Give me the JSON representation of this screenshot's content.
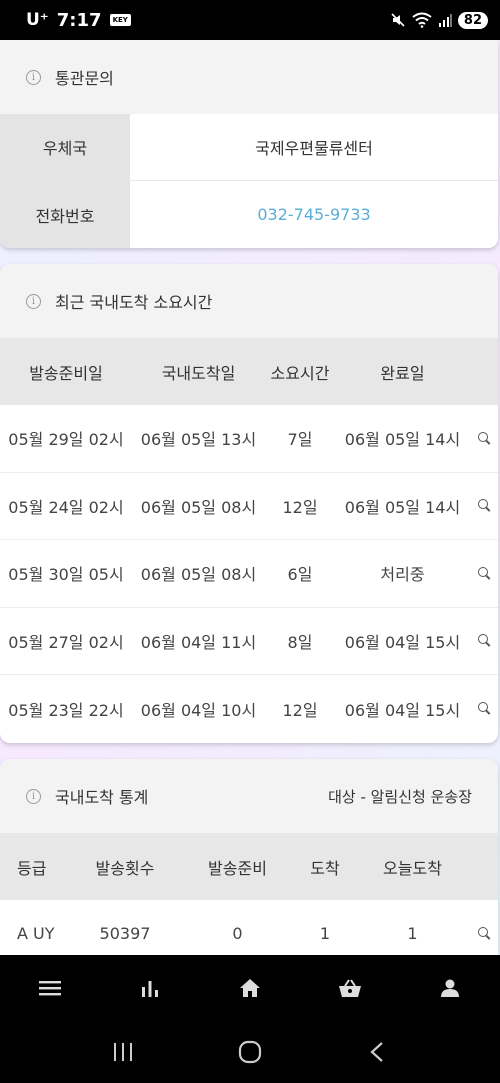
{
  "status_bar": {
    "carrier": "U⁺",
    "time": "7:17",
    "key_badge": "KEY",
    "battery": "82"
  },
  "customs": {
    "title": "통관문의",
    "rows": [
      {
        "label": "우체국",
        "value": "국제우편물류센터"
      },
      {
        "label": "전화번호",
        "value": "032-745-9733"
      }
    ]
  },
  "arrival": {
    "title": "최근 국내도착 소요시간",
    "headers": [
      "발송준비일",
      "국내도착일",
      "소요시간",
      "완료일"
    ],
    "rows": [
      {
        "ready": "05월 29일 02시",
        "arrived": "06월 05일 13시",
        "duration": "7일",
        "done": "06월 05일 14시"
      },
      {
        "ready": "05월 24일 02시",
        "arrived": "06월 05일 08시",
        "duration": "12일",
        "done": "06월 05일 14시"
      },
      {
        "ready": "05월 30일 05시",
        "arrived": "06월 05일 08시",
        "duration": "6일",
        "done": "처리중"
      },
      {
        "ready": "05월 27일 02시",
        "arrived": "06월 04일 11시",
        "duration": "8일",
        "done": "06월 04일 15시"
      },
      {
        "ready": "05월 23일 22시",
        "arrived": "06월 04일 10시",
        "duration": "12일",
        "done": "06월 04일 15시"
      }
    ]
  },
  "stats": {
    "title": "국내도착 통계",
    "subtitle": "대상 - 알림신청 운송장",
    "headers": [
      "등급",
      "발송횟수",
      "발송준비",
      "도착",
      "오늘도착"
    ],
    "rows": [
      {
        "grade": "A UY",
        "sent": "50397",
        "ready": "0",
        "arrived": "1",
        "today": "1"
      }
    ]
  },
  "icons": {
    "info": "info-circle-icon",
    "search": "search-icon",
    "nav": [
      "menu-icon",
      "bar-chart-icon",
      "home-icon",
      "basket-icon",
      "person-icon"
    ],
    "system_nav": [
      "recent-apps-icon",
      "home-circle-icon",
      "back-icon"
    ]
  },
  "colors": {
    "phone_link": "#5aaed6",
    "header_bg": "#f3f3f3",
    "table_header_bg": "#e7e7e7",
    "label_bg": "#e4e4e4"
  }
}
